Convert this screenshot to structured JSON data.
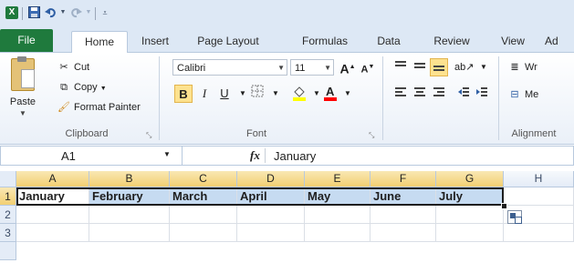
{
  "quick_access": {
    "logo_letter": "X",
    "save_icon": "save-icon",
    "undo_icon": "undo-icon",
    "redo_icon": "redo-icon",
    "customize_icon": "customize-qat-icon"
  },
  "tabs": [
    {
      "label": "File"
    },
    {
      "label": "Home"
    },
    {
      "label": "Insert"
    },
    {
      "label": "Page Layout"
    },
    {
      "label": "Formulas"
    },
    {
      "label": "Data"
    },
    {
      "label": "Review"
    },
    {
      "label": "View"
    },
    {
      "label": "Ad"
    }
  ],
  "clipboard": {
    "paste_label": "Paste",
    "cut_label": "Cut",
    "copy_label": "Copy",
    "format_painter_label": "Format Painter",
    "group_label": "Clipboard"
  },
  "font": {
    "font_name": "Calibri",
    "font_size": "11",
    "grow_label": "A",
    "shrink_label": "A",
    "bold_label": "B",
    "italic_label": "I",
    "underline_label": "U",
    "fill_color": "#ffff00",
    "font_color": "#ff0000",
    "group_label": "Font"
  },
  "alignment": {
    "wrap_label": "Wr",
    "merge_label": "Me",
    "group_label": "Alignment"
  },
  "formula_bar": {
    "name_box": "A1",
    "fx_label": "fx",
    "value": "January"
  },
  "sheet": {
    "columns": [
      "A",
      "B",
      "C",
      "D",
      "E",
      "F",
      "G",
      "H"
    ],
    "rows": [
      "1",
      "2",
      "3"
    ],
    "row1": [
      "January",
      "February",
      "March",
      "April",
      "May",
      "June",
      "July"
    ]
  }
}
